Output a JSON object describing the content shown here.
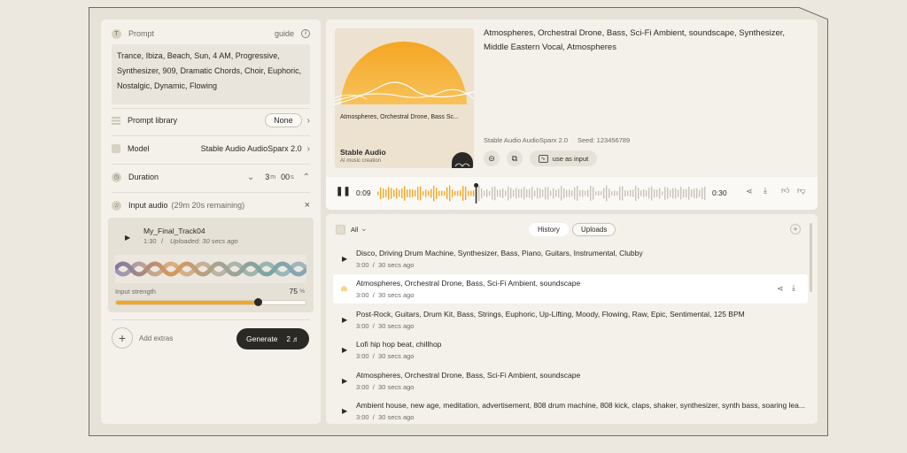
{
  "prompt": {
    "label": "Prompt",
    "guide_label": "guide",
    "text": "Trance, Ibiza, Beach, Sun, 4 AM, Progressive, Synthesizer, 909, Dramatic Chords, Choir, Euphoric, Nostalgic, Dynamic, Flowing"
  },
  "prompt_library": {
    "label": "Prompt library",
    "value": "None"
  },
  "model": {
    "label": "Model",
    "value": "Stable Audio AudioSparx 2.0"
  },
  "duration": {
    "label": "Duration",
    "minutes": "3",
    "min_unit": "m",
    "seconds": "00",
    "sec_unit": "s"
  },
  "input_audio": {
    "label": "Input audio",
    "remaining": "(29m 20s remaining)",
    "track_name": "My_Final_Track04",
    "track_length": "1:30",
    "uploaded": "Uploaded: 30 secs ago",
    "strength_label": "Input strength",
    "strength_value": "75",
    "strength_unit": "%",
    "strength_fraction": 0.75
  },
  "actions": {
    "add_extras": "Add extras",
    "generate": "Generate",
    "generate_cost": "2"
  },
  "player": {
    "description": "Atmospheres, Orchestral Drone, Bass, Sci-Fi Ambient, soundscape, Synthesizer, Middle Eastern Vocal, Atmospheres",
    "cover_caption": "Atmospheres, Orchestral Drone, Bass Sc...",
    "cover_brand": "Stable Audio",
    "cover_sub": "AI music creation",
    "model": "Stable Audio AudioSparx 2.0",
    "seed": "Seed: 123456789",
    "use_as_input": "use as input",
    "current_time": "0:09",
    "total_time": "0:30",
    "progress_fraction": 0.3
  },
  "history": {
    "filter_label": "All",
    "tabs": [
      "History",
      "Uploads"
    ],
    "items": [
      {
        "title": "Disco, Driving Drum Machine, Synthesizer, Bass, Piano, Guitars, Instrumental, Clubby",
        "duration": "3:00",
        "age": "30 secs ago"
      },
      {
        "title": "Atmospheres, Orchestral Drone, Bass, Sci-Fi Ambient, soundscape",
        "duration": "3:00",
        "age": "30 secs ago"
      },
      {
        "title": "Post-Rock, Guitars, Drum Kit, Bass, Strings, Euphoric, Up-Lifting, Moody, Flowing, Raw, Epic, Sentimental, 125 BPM",
        "duration": "3:00",
        "age": "30 secs ago"
      },
      {
        "title": "Lofi hip hop beat, chillhop",
        "duration": "3:00",
        "age": "30 secs ago"
      },
      {
        "title": "Atmospheres, Orchestral Drone, Bass, Sci-Fi Ambient, soundscape",
        "duration": "3:00",
        "age": "30 secs ago"
      },
      {
        "title": "Ambient house, new age, meditation, advertisement, 808 drum machine, 808 kick, claps, shaker, synthesizer, synth bass, soaring lea...",
        "duration": "3:00",
        "age": "30 secs ago"
      }
    ]
  },
  "colors": {
    "accent": "#f5a623",
    "dark": "#2b2926",
    "panel": "#f4f1eb"
  }
}
